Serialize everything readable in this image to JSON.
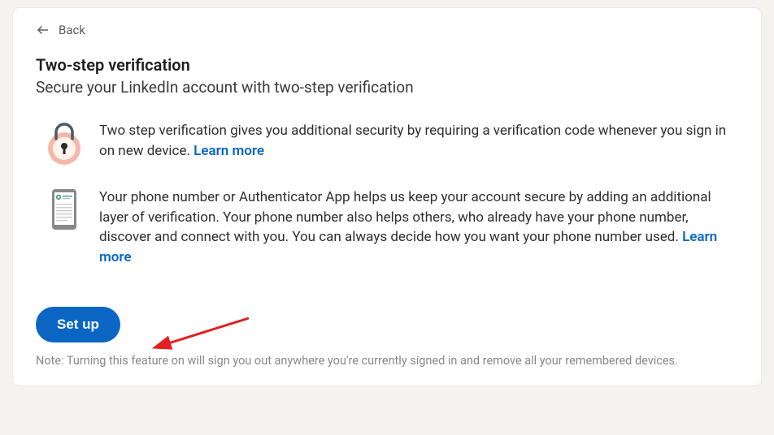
{
  "back": {
    "label": "Back"
  },
  "title": "Two-step verification",
  "subtitle": "Secure your LinkedIn account with two-step verification",
  "blocks": {
    "lock": {
      "text": "Two step verification gives you additional security by requiring a verification code whenever you sign in on new device. ",
      "link": "Learn more"
    },
    "phone": {
      "text": "Your phone number or Authenticator App helps us keep your account secure by adding an additional layer of verification. Your phone number also helps others, who already have your phone number, discover and connect with you. You can always decide how you want your phone number used. ",
      "link": "Learn more"
    }
  },
  "setup_label": "Set up",
  "note": "Note: Turning this feature on will sign you out anywhere you're currently signed in and remove all your remembered devices."
}
